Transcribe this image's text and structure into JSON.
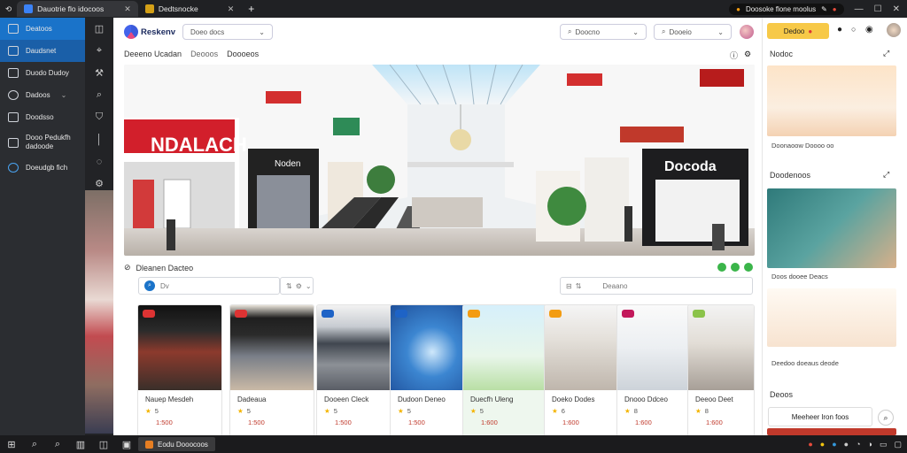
{
  "browser": {
    "tabs": [
      {
        "label": "Dauotrie flo idocoos",
        "active": true
      },
      {
        "label": "Dedtsnocke",
        "active": false
      }
    ],
    "newtab_icon": "plus",
    "extension_label": "Doosoke flone moolus"
  },
  "sidebar": {
    "items": [
      {
        "label": "Deatoos",
        "icon": "grid-icon"
      },
      {
        "label": "Daudsnet",
        "icon": "inbox-icon"
      },
      {
        "label": "Duodo Dudoy",
        "icon": "store-icon"
      },
      {
        "label": "Dadoos",
        "icon": "cart-icon"
      },
      {
        "label": "Doodsso",
        "icon": "list-icon"
      },
      {
        "label": "Dooo Pedukfh dadoode",
        "icon": "image-icon"
      },
      {
        "label": "Doeudgb fich",
        "icon": "globe-icon"
      }
    ]
  },
  "topnav": {
    "brand": "Reskenv",
    "dropdown1": "Doeo docs",
    "dropdown2": "Doocno",
    "dropdown3": "Dooeio"
  },
  "breadcrumbs": [
    "Deeeno Ucadan",
    "Deooos",
    "Doooeos"
  ],
  "section": {
    "title": "Dleanen Dacteo",
    "search_placeholder": "Dv",
    "filter_label": "Deaano"
  },
  "cards": [
    {
      "title": "Nauep Mesdeh",
      "rating": "5",
      "price": "1:500",
      "badge_color": "#d33"
    },
    {
      "title": "Dadeaua",
      "rating": "5",
      "price": "1:500",
      "badge_color": "#d33"
    },
    {
      "title": "Dooeen Cleck",
      "rating": "5",
      "price": "1:500",
      "badge_color": "#1e63c6"
    },
    {
      "title": "Dudoon Deneo",
      "rating": "5",
      "price": "1:500",
      "badge_color": "#1e63c6"
    },
    {
      "title": "Duecfh Uleng",
      "rating": "5",
      "price": "1:600",
      "badge_color": "#f39c12"
    },
    {
      "title": "Doeko Dodes",
      "rating": "6",
      "price": "1:600",
      "badge_color": "#f39c12"
    },
    {
      "title": "Dnooo Ddceo",
      "rating": "8",
      "price": "1:600",
      "badge_color": "#c2185b"
    },
    {
      "title": "Deeoo Deet",
      "rating": "8",
      "price": "1:600",
      "badge_color": "#8bc34a"
    }
  ],
  "right_panel": {
    "badge": "Dedoo",
    "header1": "Nodoc",
    "caption1": "Doonaoow Doooo oo",
    "header2": "Doodenoos",
    "caption2": "Doos dooee Deacs",
    "caption3": "Deedoo doeaus deode",
    "header3": "Deoos",
    "button": "Meeheer lron foos"
  },
  "taskbar": {
    "app_label": "Eodu Dooocoos"
  },
  "colors": {
    "accent": "#1a73c9",
    "price": "#c0392b",
    "rating": "#f4b400",
    "badge_yellow": "#f7c948",
    "green": "#3bb54a"
  }
}
